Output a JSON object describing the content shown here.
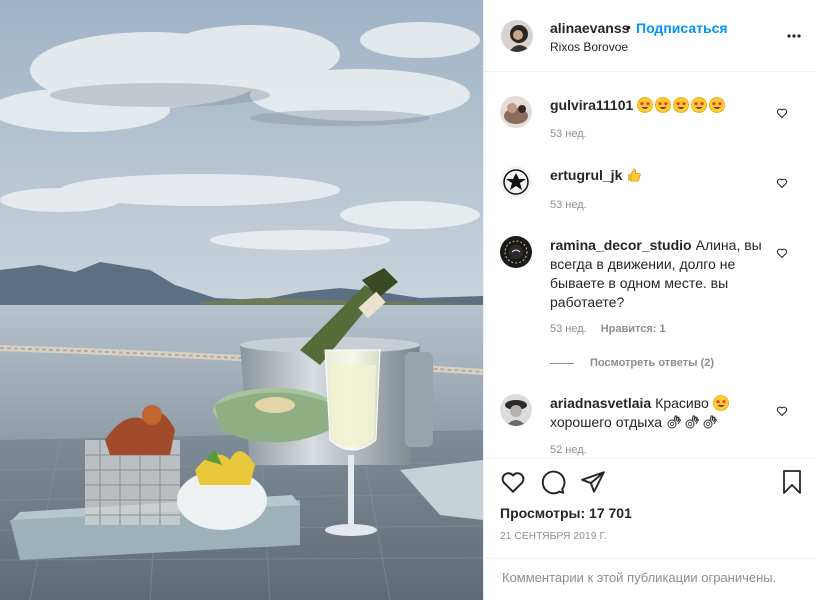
{
  "post": {
    "username": "alinaevanss",
    "separator": "•",
    "follow_label": "Подписаться",
    "location": "Rixos Borovoe",
    "more_icon": "more-horizontal-icon"
  },
  "comments": [
    {
      "username": "gulvira11101",
      "text": "",
      "emojis": [
        "star-struck",
        "star-struck",
        "star-struck",
        "star-struck",
        "star-struck"
      ],
      "time": "53 нед."
    },
    {
      "username": "ertugrul_jk",
      "text": "",
      "emojis": [
        "thumbs-up"
      ],
      "time": "53 нед."
    },
    {
      "username": "ramina_decor_studio",
      "text": "Алина, вы всегда в движении, долго не бываете в одном месте. вы работаете?",
      "time": "53 нед.",
      "likes": "Нравится: 1",
      "replies": "Посмотреть ответы (2)"
    },
    {
      "username": "ariadnasvetlaia",
      "text": "Красиво",
      "text2": "хорошего отдыха",
      "emojis": [
        "star-struck"
      ],
      "emojis2": [
        "ok-hand",
        "ok-hand",
        "ok-hand"
      ],
      "time": "52 нед."
    }
  ],
  "actions": {
    "icons": [
      "heart-icon",
      "comment-icon",
      "share-icon",
      "bookmark-icon"
    ],
    "views": "Просмотры: 17 701",
    "date": "21 СЕНТЯБРЯ 2019 Г."
  },
  "comments_limited": "Комментарии к этой публикации ограничены.",
  "colors": {
    "link_blue": "#0095f6",
    "text": "#262626",
    "muted": "#8e8e8e",
    "border": "#efefef"
  }
}
